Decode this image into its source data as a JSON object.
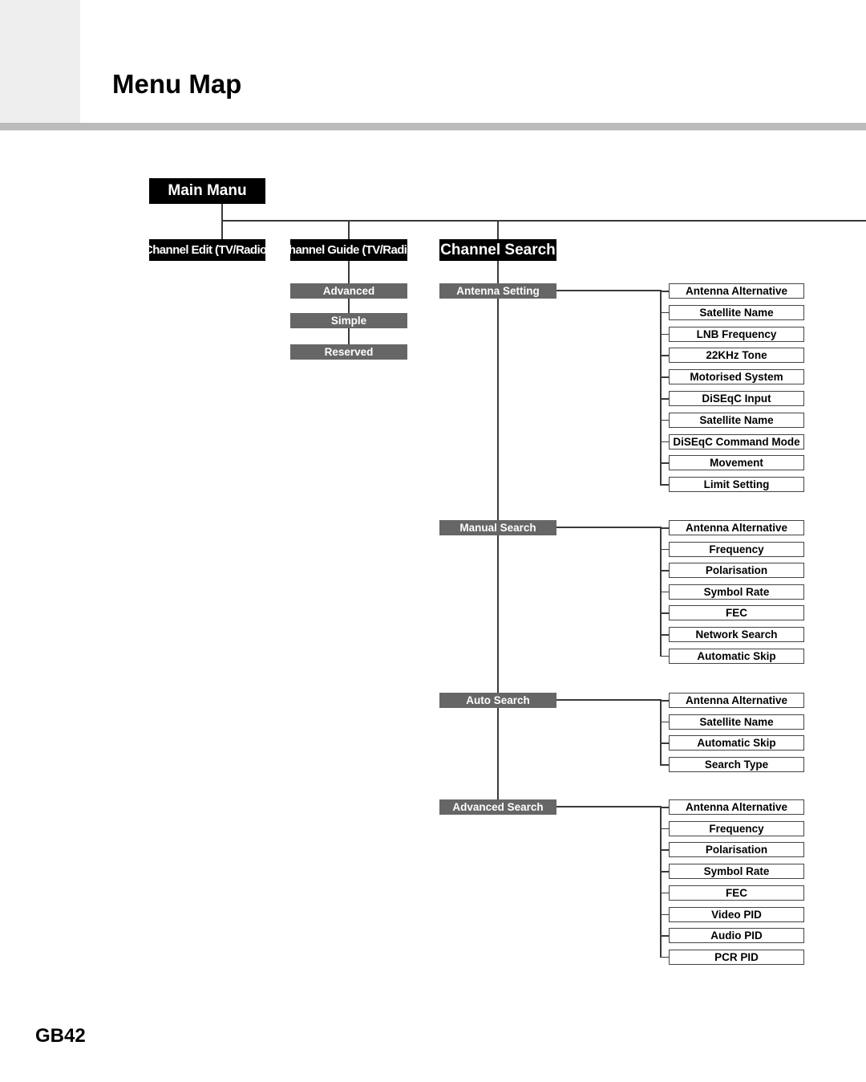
{
  "page": {
    "title": "Menu Map",
    "footer_code": "GB42"
  },
  "menu_map": {
    "root": "Main Manu",
    "level1": [
      {
        "label": "Channel Edit (TV/Radio)",
        "children": []
      },
      {
        "label": "Channel Guide (TV/Radio)",
        "children": [
          "Advanced",
          "Simple",
          "Reserved"
        ]
      },
      {
        "label": "Channel Search"
      }
    ],
    "channel_search_groups": [
      {
        "label": "Antenna Setting",
        "items": [
          "Antenna Alternative",
          "Satellite Name",
          "LNB Frequency",
          "22KHz Tone",
          "Motorised System",
          "DiSEqC Input",
          "Satellite Name",
          "DiSEqC Command Mode",
          "Movement",
          "Limit Setting"
        ]
      },
      {
        "label": "Manual Search",
        "items": [
          "Antenna Alternative",
          "Frequency",
          "Polarisation",
          "Symbol Rate",
          "FEC",
          "Network Search",
          "Automatic Skip"
        ]
      },
      {
        "label": "Auto Search",
        "items": [
          "Antenna Alternative",
          "Satellite Name",
          "Automatic Skip",
          "Search Type"
        ]
      },
      {
        "label": "Advanced Search",
        "items": [
          "Antenna Alternative",
          "Frequency",
          "Polarisation",
          "Symbol Rate",
          "FEC",
          "Video PID",
          "Audio PID",
          "PCR PID"
        ]
      }
    ]
  }
}
